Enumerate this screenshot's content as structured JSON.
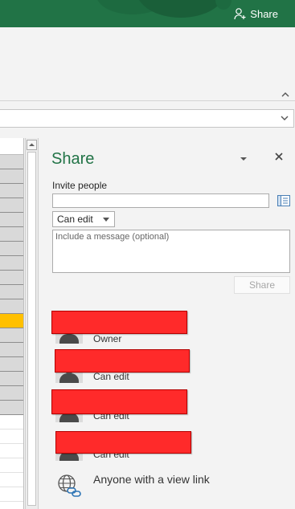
{
  "app": {
    "share_button_label": "Share",
    "accent_color": "#217346"
  },
  "share_pane": {
    "title": "Share",
    "invite_label": "Invite people",
    "invite_value": "",
    "permission_selected": "Can edit",
    "message_placeholder": "Include a message (optional)",
    "share_button_label": "Share",
    "people": [
      {
        "role": "Owner",
        "name_redacted": true
      },
      {
        "role": "Can edit",
        "name_redacted": true
      },
      {
        "role": "Can edit",
        "name_redacted": true
      },
      {
        "role": "Can edit",
        "name_redacted": true
      }
    ],
    "view_link_label": "Anyone with a view link"
  },
  "sheet": {
    "highlight_color": "#ffc000",
    "redaction_color": "#ff2a2a"
  }
}
